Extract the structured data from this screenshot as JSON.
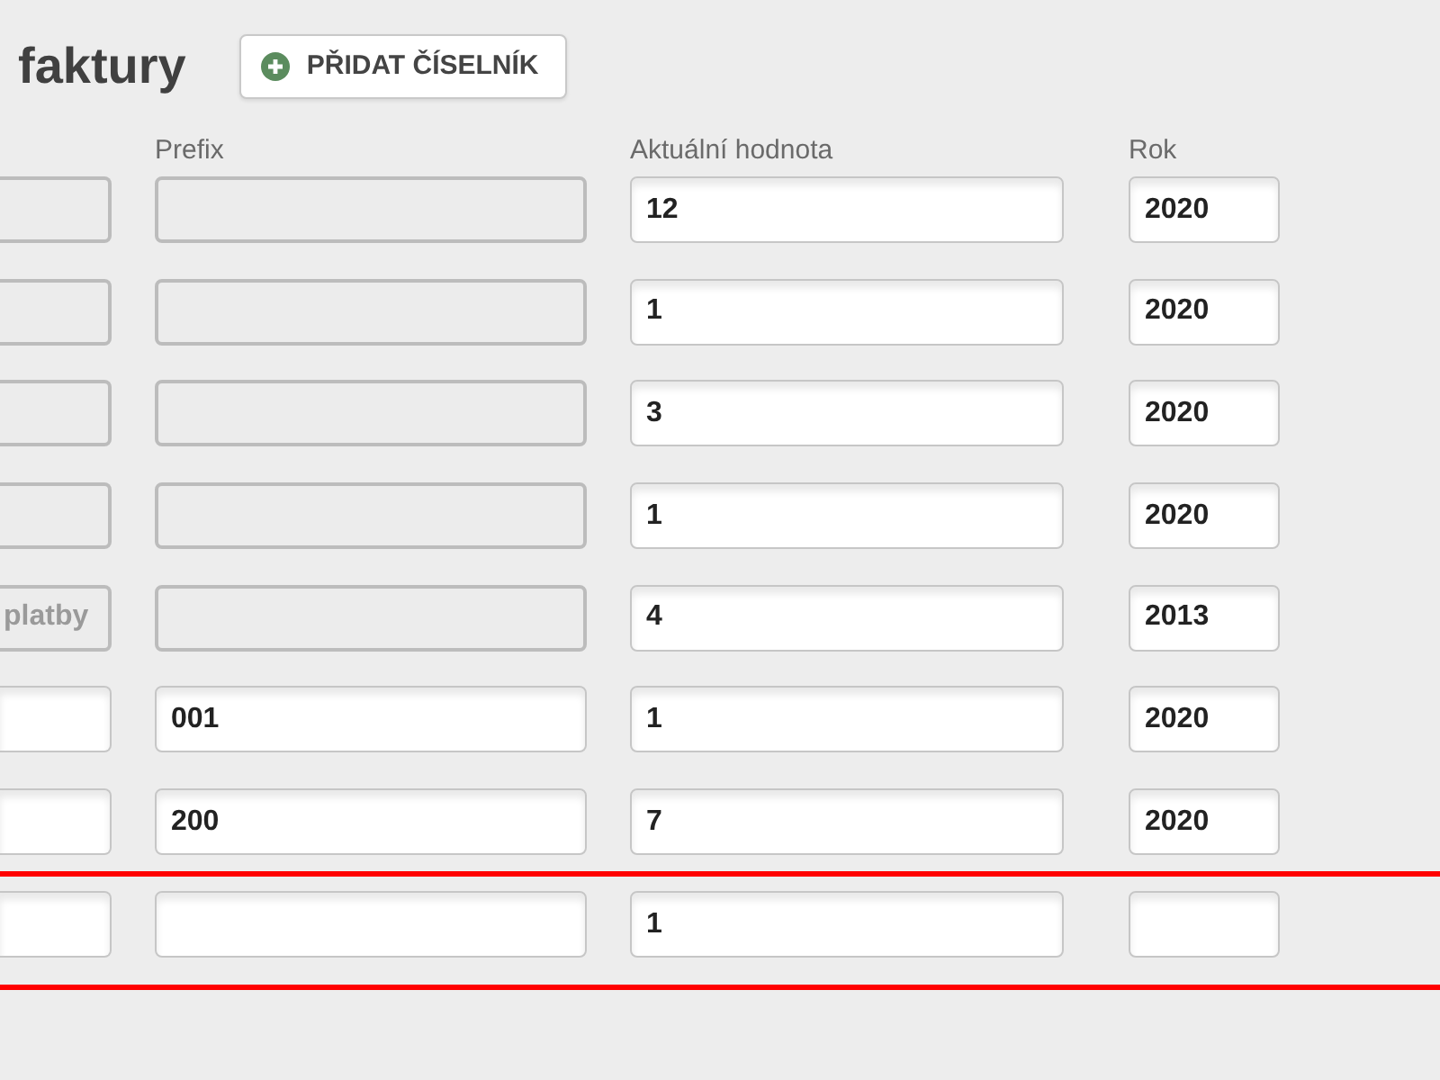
{
  "page": {
    "title": "faktury"
  },
  "add_button": {
    "label": "PŘIDAT ČÍSELNÍK"
  },
  "headers": {
    "prefix": "Prefix",
    "current_value": "Aktuální hodnota",
    "year": "Rok"
  },
  "rows": [
    {
      "highlighted": false,
      "column_1": {
        "disabled": true
      },
      "prefix": {
        "disabled": true
      },
      "current_value": {
        "value": "12",
        "disabled": false
      },
      "year": {
        "value": "2020",
        "disabled": false
      }
    },
    {
      "highlighted": false,
      "column_1": {
        "disabled": true
      },
      "prefix": {
        "disabled": true
      },
      "current_value": {
        "value": "1",
        "disabled": false
      },
      "year": {
        "value": "2020",
        "disabled": false
      }
    },
    {
      "highlighted": false,
      "column_1": {
        "disabled": true
      },
      "prefix": {
        "disabled": true
      },
      "current_value": {
        "value": "3",
        "disabled": false
      },
      "year": {
        "value": "2020",
        "disabled": false
      }
    },
    {
      "highlighted": false,
      "column_1": {
        "disabled": true
      },
      "prefix": {
        "disabled": true
      },
      "current_value": {
        "value": "1",
        "disabled": false
      },
      "year": {
        "value": "2020",
        "disabled": false
      }
    },
    {
      "highlighted": false,
      "column_1": {
        "value": "platby",
        "disabled": true
      },
      "prefix": {
        "disabled": true
      },
      "current_value": {
        "value": "4",
        "disabled": false
      },
      "year": {
        "value": "2013",
        "disabled": false
      }
    },
    {
      "highlighted": false,
      "column_1": {
        "disabled": false
      },
      "prefix": {
        "value": "001",
        "disabled": false
      },
      "current_value": {
        "value": "1",
        "disabled": false
      },
      "year": {
        "value": "2020",
        "disabled": false
      }
    },
    {
      "highlighted": false,
      "column_1": {
        "disabled": false
      },
      "prefix": {
        "value": "200",
        "disabled": false
      },
      "current_value": {
        "value": "7",
        "disabled": false
      },
      "year": {
        "value": "2020",
        "disabled": false
      }
    },
    {
      "highlighted": true,
      "column_1": {
        "disabled": false
      },
      "prefix": {
        "disabled": false
      },
      "current_value": {
        "value": "1",
        "disabled": false
      },
      "year": {
        "disabled": false
      }
    }
  ]
}
